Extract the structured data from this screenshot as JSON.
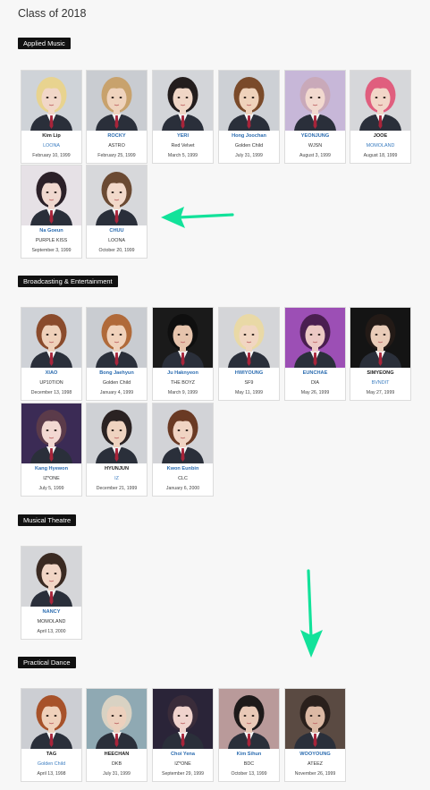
{
  "title": "Class of 2018",
  "colors": {
    "accent": "#12e29a",
    "link": "#2b6cb0",
    "label_bg": "#111111"
  },
  "sections": [
    {
      "label": "Applied Music",
      "cards": [
        {
          "name": "Kim Lip",
          "group": "LOONA",
          "date": "February 10, 1999",
          "name_link": false,
          "group_link": true,
          "bg": "#cfd3d8",
          "hair": "#e8d38f",
          "skin": "#f1d7c8"
        },
        {
          "name": "ROCKY",
          "group": "ASTRO",
          "date": "February 25, 1999",
          "name_link": true,
          "group_link": false,
          "bg": "#c9ccd1",
          "hair": "#c8a26d",
          "skin": "#efd3bd"
        },
        {
          "name": "YERI",
          "group": "Red Velvet",
          "date": "March 5, 1999",
          "name_link": true,
          "group_link": false,
          "bg": "#d3d5d9",
          "hair": "#231d1d",
          "skin": "#f0d6c6"
        },
        {
          "name": "Hong Joochan",
          "group": "Golden Child",
          "date": "July 31, 1999",
          "name_link": true,
          "group_link": false,
          "bg": "#cdd0d5",
          "hair": "#7a4a2a",
          "skin": "#efd2bb"
        },
        {
          "name": "YEONJUNG",
          "group": "WJSN",
          "date": "August 3, 1999",
          "name_link": true,
          "group_link": false,
          "bg": "#c7b7d8",
          "hair": "#c9a9b9",
          "skin": "#f2d9cf"
        },
        {
          "name": "JOOE",
          "group": "MOMOLAND",
          "date": "August 18, 1999",
          "name_link": false,
          "group_link": true,
          "bg": "#d6d7da",
          "hair": "#e05e7e",
          "skin": "#f2d6c8"
        },
        {
          "name": "Na Goeun",
          "group": "PURPLE KISS",
          "date": "September 3, 1999",
          "name_link": true,
          "group_link": false,
          "bg": "#e6e1e6",
          "hair": "#2b2028",
          "skin": "#f0d8cf"
        },
        {
          "name": "CHUU",
          "group": "LOONA",
          "date": "October 20, 1999",
          "name_link": true,
          "group_link": false,
          "bg": "#d7d8db",
          "hair": "#6b4a33",
          "skin": "#f2d9ca"
        }
      ]
    },
    {
      "label": "Broadcasting & Entertainment",
      "cards": [
        {
          "name": "XIAO",
          "group": "UP10TION",
          "date": "December 13, 1998",
          "name_link": true,
          "group_link": false,
          "bg": "#cfd2d7",
          "hair": "#8a4b2c",
          "skin": "#efd1ba"
        },
        {
          "name": "Bong Jaehyun",
          "group": "Golden Child",
          "date": "January 4, 1999",
          "name_link": true,
          "group_link": false,
          "bg": "#c9ccd1",
          "hair": "#b06a3a",
          "skin": "#f0d2bb"
        },
        {
          "name": "Ju Haknyeon",
          "group": "THE BOYZ",
          "date": "March 9, 1999",
          "name_link": true,
          "group_link": false,
          "bg": "#1a1a1a",
          "hair": "#0f0f0f",
          "skin": "#e6c4ad"
        },
        {
          "name": "HWIYOUNG",
          "group": "SF9",
          "date": "May 11, 1999",
          "name_link": true,
          "group_link": false,
          "bg": "#d4d5d8",
          "hair": "#e9d9a6",
          "skin": "#f1d6c2"
        },
        {
          "name": "EUNCHAE",
          "group": "DIA",
          "date": "May 26, 1999",
          "name_link": true,
          "group_link": false,
          "bg": "#9c4fb5",
          "hair": "#4a1f50",
          "skin": "#ecc9c4"
        },
        {
          "name": "SIMYEONG",
          "group": "BVNDIT",
          "date": "May 27, 1999",
          "name_link": false,
          "group_link": true,
          "bg": "#141414",
          "hair": "#231a16",
          "skin": "#e9ccb8"
        },
        {
          "name": "Kang Hyewon",
          "group": "IZ*ONE",
          "date": "July 5, 1999",
          "name_link": true,
          "group_link": false,
          "bg": "#3b2b55",
          "hair": "#5b3b4a",
          "skin": "#f2d8d2"
        },
        {
          "name": "HYUNJUN",
          "group": "IZ",
          "date": "December 21, 1999",
          "name_link": false,
          "group_link": true,
          "bg": "#cfd1d5",
          "hair": "#2a2222",
          "skin": "#efd3c0"
        },
        {
          "name": "Kwon Eunbin",
          "group": "CLC",
          "date": "January 6, 2000",
          "name_link": true,
          "group_link": false,
          "bg": "#d2d3d7",
          "hair": "#6a3a24",
          "skin": "#f0d4c3"
        }
      ]
    },
    {
      "label": "Musical Theatre",
      "cards": [
        {
          "name": "NANCY",
          "group": "MOMOLAND",
          "date": "April 13, 2000",
          "name_link": true,
          "group_link": false,
          "bg": "#d5d6d9",
          "hair": "#3a2a22",
          "skin": "#f1d6c6"
        }
      ]
    },
    {
      "label": "Practical Dance",
      "cards": [
        {
          "name": "TAG",
          "group": "Golden Child",
          "date": "April 13, 1998",
          "name_link": false,
          "group_link": true,
          "bg": "#ccced3",
          "hair": "#a7522a",
          "skin": "#efd1bb"
        },
        {
          "name": "HEECHAN",
          "group": "DKB",
          "date": "July 31, 1999",
          "name_link": false,
          "group_link": false,
          "bg": "#8fa9b3",
          "hair": "#d9d2c3",
          "skin": "#ecd0bd"
        },
        {
          "name": "Choi Yena",
          "group": "IZ*ONE",
          "date": "September 29, 1999",
          "name_link": true,
          "group_link": false,
          "bg": "#2a2438",
          "hair": "#3a2c3a",
          "skin": "#f0d3cd"
        },
        {
          "name": "Kim Sihun",
          "group": "BDC",
          "date": "October 13, 1999",
          "name_link": true,
          "group_link": false,
          "bg": "#b99a9a",
          "hair": "#1e1a1a",
          "skin": "#e9c9b7"
        },
        {
          "name": "WOOYOUNG",
          "group": "ATEEZ",
          "date": "November 26, 1999",
          "name_link": true,
          "group_link": false,
          "bg": "#5a4a42",
          "hair": "#2a201c",
          "skin": "#dcb9a4"
        }
      ]
    }
  ]
}
